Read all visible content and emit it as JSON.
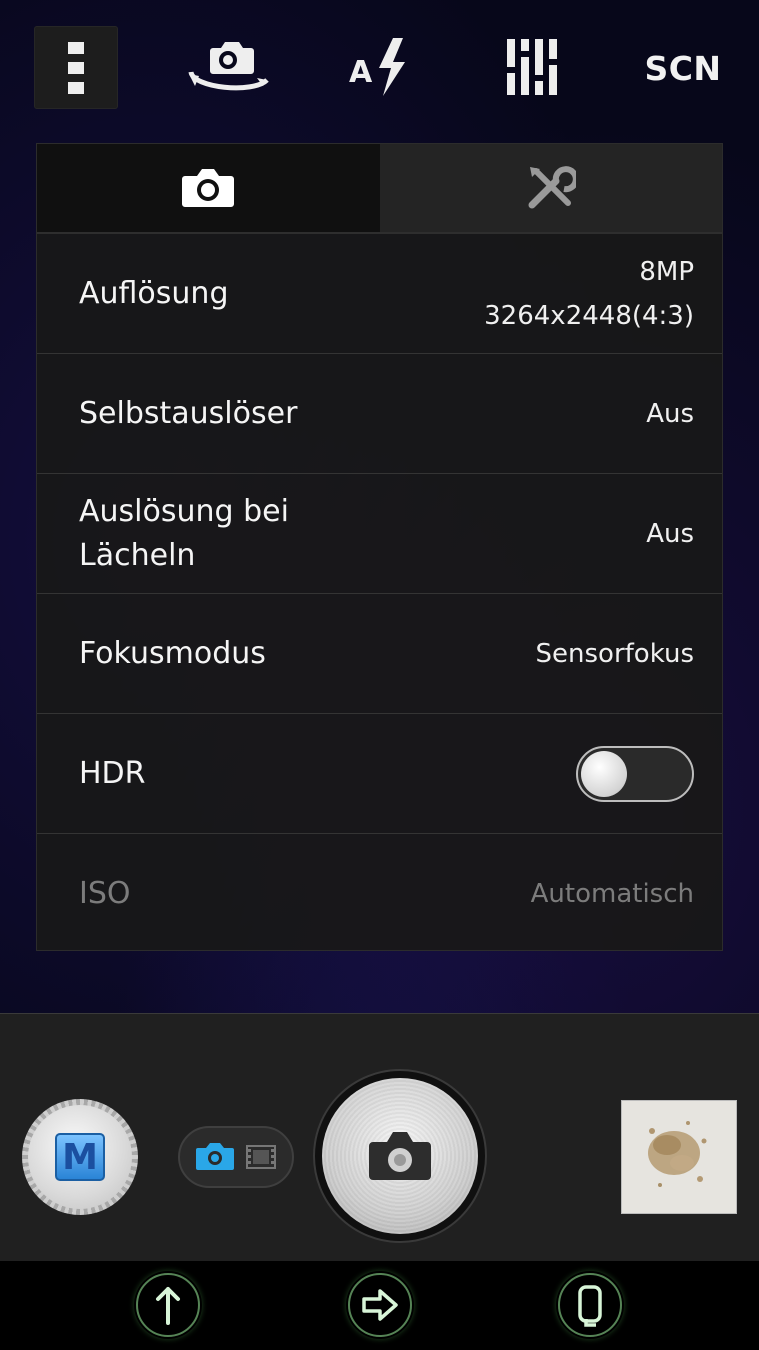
{
  "toolbar": {
    "menu_icon": "vertical-dots-icon",
    "rotate_icon": "switch-camera-icon",
    "flash_icon": "auto-flash-icon",
    "adjust_icon": "sliders-icon",
    "scene_label": "SCN"
  },
  "settings": {
    "tabs": [
      {
        "icon": "camera-icon",
        "active": true
      },
      {
        "icon": "tools-icon",
        "active": false
      }
    ],
    "rows": [
      {
        "label": "Auflösung",
        "value_line1": "8MP",
        "value_line2": "3264x2448(4:3)"
      },
      {
        "label": "Selbstauslöser",
        "value": "Aus"
      },
      {
        "label": "Auslösung bei Lächeln",
        "value": "Aus"
      },
      {
        "label": "Fokusmodus",
        "value": "Sensorfokus"
      },
      {
        "label": "HDR",
        "toggle_on": false
      },
      {
        "label": "ISO",
        "value": "Automatisch",
        "disabled": true
      }
    ]
  },
  "controls": {
    "mode_badge": "M",
    "switcher_icons": [
      "camera-icon",
      "film-icon"
    ],
    "shutter_icon": "camera-icon",
    "thumbnail": "last-photo-thumbnail"
  },
  "nav": {
    "icons": [
      "up-arrow-icon",
      "right-arrow-icon",
      "phone-icon"
    ]
  },
  "colors": {
    "accent_blue": "#2aa7e8",
    "nav_glow": "#9cf29c"
  }
}
